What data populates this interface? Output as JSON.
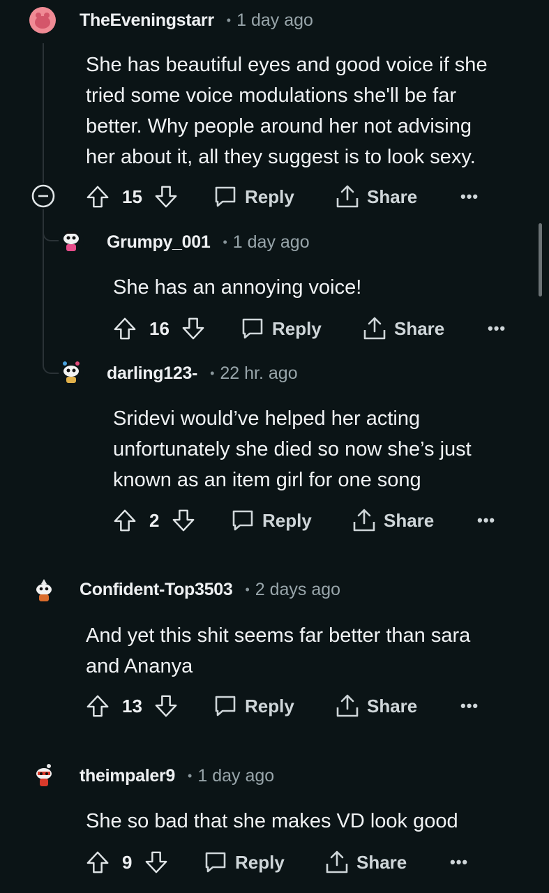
{
  "comments": [
    {
      "username": "TheEveningstarr",
      "time": "1 day ago",
      "text": "She has beautiful eyes and good voice if she\ntried some voice modulations she'll be far\nbetter. Why people around her not advising\nher about it, all they suggest is to look sexy.",
      "votes": "15",
      "reply_label": "Reply",
      "share_label": "Share",
      "more_label": "•••"
    },
    {
      "username": "Grumpy_001",
      "time": "1 day ago",
      "text": "She has an annoying voice!",
      "votes": "16",
      "reply_label": "Reply",
      "share_label": "Share",
      "more_label": "•••"
    },
    {
      "username": "darling123-",
      "time": "22 hr. ago",
      "text": "Sridevi would’ve helped her acting\nunfortunately she died so now she’s just\nknown as an item girl for one song",
      "votes": "2",
      "reply_label": "Reply",
      "share_label": "Share",
      "more_label": "•••"
    },
    {
      "username": "Confident-Top3503",
      "time": "2 days ago",
      "text": "And yet this shit seems far better than sara\nand Ananya",
      "votes": "13",
      "reply_label": "Reply",
      "share_label": "Share",
      "more_label": "•••"
    },
    {
      "username": "theimpaler9",
      "time": "1 day ago",
      "text": "She so bad that she makes VD look good",
      "votes": "9",
      "reply_label": "Reply",
      "share_label": "Share",
      "more_label": "•••"
    }
  ],
  "separator": "•",
  "icons": {
    "upvote": "upvote-icon",
    "downvote": "downvote-icon",
    "reply": "reply-bubble-icon",
    "share": "share-icon",
    "collapse": "collapse-minus-icon"
  },
  "colors": {
    "background": "#0b1416",
    "text": "#f0f2f4",
    "muted": "#98a5aa",
    "action": "#cfd6d9"
  }
}
